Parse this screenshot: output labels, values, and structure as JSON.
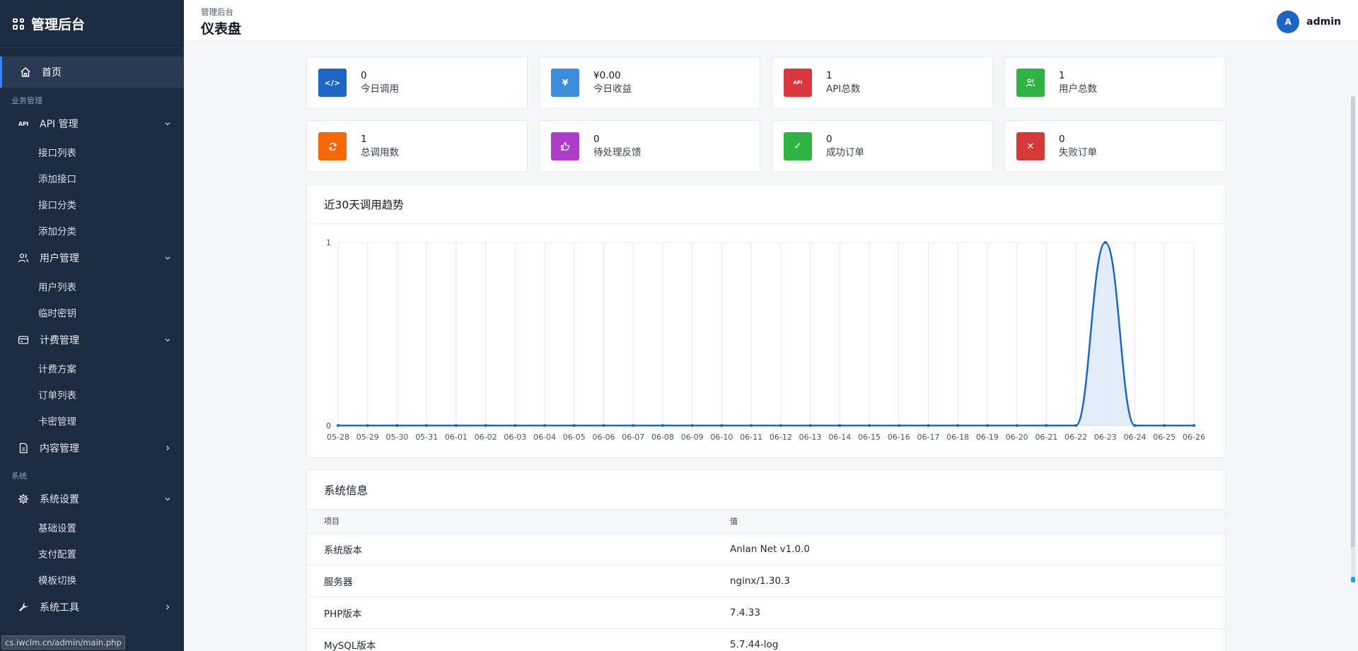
{
  "brand": {
    "title": "管理后台"
  },
  "sidebar": {
    "home": "首页",
    "section_business": "业务管理",
    "section_system": "系统",
    "groups": [
      {
        "label": "API 管理",
        "icon": "api-icon",
        "items": [
          "接口列表",
          "添加接口",
          "接口分类",
          "添加分类"
        ]
      },
      {
        "label": "用户管理",
        "icon": "users-icon",
        "items": [
          "用户列表",
          "临时密钥"
        ]
      },
      {
        "label": "计费管理",
        "icon": "card-icon",
        "items": [
          "计费方案",
          "订单列表",
          "卡密管理"
        ]
      },
      {
        "label": "内容管理",
        "icon": "document-icon",
        "items": []
      },
      {
        "label": "系统设置",
        "icon": "gear-icon",
        "items": [
          "基础设置",
          "支付配置",
          "模板切换"
        ]
      },
      {
        "label": "系统工具",
        "icon": "wrench-icon",
        "items": []
      }
    ],
    "api_tag": "API"
  },
  "statusbar": {
    "url": "cs.iwclm.cn/admin/main.php"
  },
  "header": {
    "breadcrumb": "管理后台",
    "title": "仪表盘",
    "user": {
      "avatar_letter": "A",
      "name": "admin"
    }
  },
  "stats": [
    {
      "value": "0",
      "label": "今日调用",
      "icon": "code-icon",
      "color": "#1e66c4",
      "glyph": "</>"
    },
    {
      "value": "¥0.00",
      "label": "今日收益",
      "icon": "yen-icon",
      "color": "#3d8fdc",
      "glyph": "¥"
    },
    {
      "value": "1",
      "label": "API总数",
      "icon": "api-icon",
      "color": "#d9363e",
      "glyph": "API"
    },
    {
      "value": "1",
      "label": "用户总数",
      "icon": "users-icon",
      "color": "#2fb344",
      "glyph": ""
    },
    {
      "value": "1",
      "label": "总调用数",
      "icon": "refresh-icon",
      "color": "#f76707",
      "glyph": ""
    },
    {
      "value": "0",
      "label": "待处理反馈",
      "icon": "thumbs-up-icon",
      "color": "#ae3ec9",
      "glyph": ""
    },
    {
      "value": "0",
      "label": "成功订单",
      "icon": "check-icon",
      "color": "#2fb344",
      "glyph": "✓"
    },
    {
      "value": "0",
      "label": "失败订单",
      "icon": "x-icon",
      "color": "#d63939",
      "glyph": "✕"
    }
  ],
  "trend": {
    "title": "近30天调用趋势"
  },
  "chart_data": {
    "type": "area",
    "x": [
      "05-28",
      "05-29",
      "05-30",
      "05-31",
      "06-01",
      "06-02",
      "06-03",
      "06-04",
      "06-05",
      "06-06",
      "06-07",
      "06-08",
      "06-09",
      "06-10",
      "06-11",
      "06-12",
      "06-13",
      "06-14",
      "06-15",
      "06-16",
      "06-17",
      "06-18",
      "06-19",
      "06-20",
      "06-21",
      "06-22",
      "06-23",
      "06-24",
      "06-25",
      "06-26"
    ],
    "values": [
      0,
      0,
      0,
      0,
      0,
      0,
      0,
      0,
      0,
      0,
      0,
      0,
      0,
      0,
      0,
      0,
      0,
      0,
      0,
      0,
      0,
      0,
      0,
      0,
      0,
      0,
      1,
      0,
      0,
      0
    ],
    "ylim": [
      0,
      1
    ],
    "yticks": [
      0,
      1
    ],
    "grid": "vertical",
    "colors": {
      "line": "#1e66c4",
      "fill": "#dce8f7"
    }
  },
  "sysinfo": {
    "title": "系统信息",
    "columns": [
      "项目",
      "值"
    ],
    "rows": [
      [
        "系统版本",
        "Anlan Net v1.0.0"
      ],
      [
        "服务器",
        "nginx/1.30.3"
      ],
      [
        "PHP版本",
        "7.4.33"
      ],
      [
        "MySQL版本",
        "5.7.44-log"
      ]
    ]
  }
}
